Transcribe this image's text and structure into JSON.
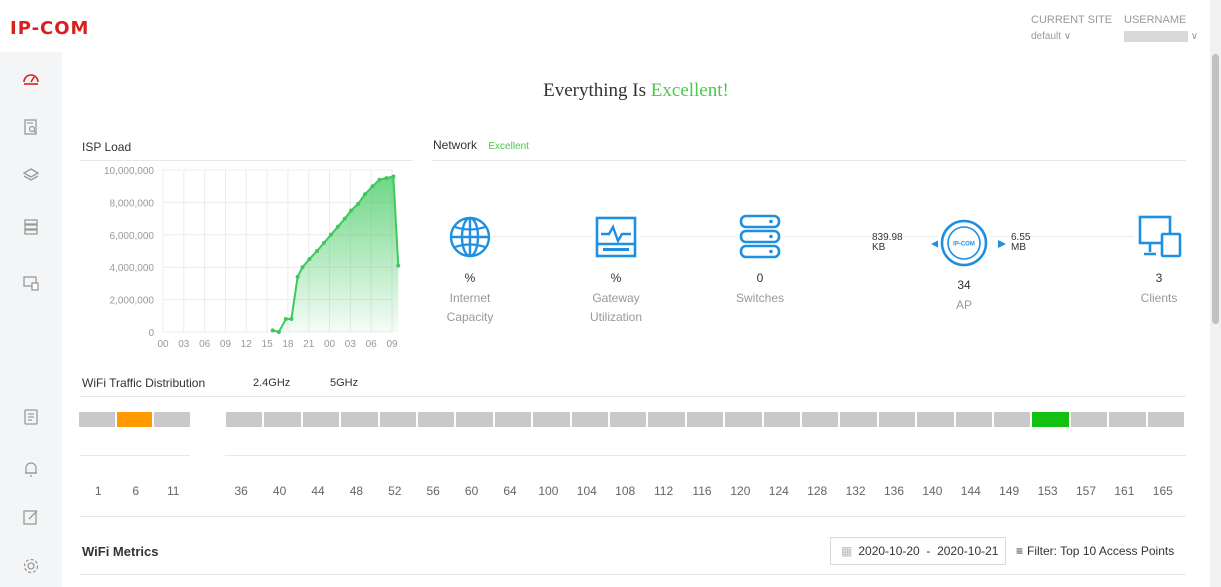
{
  "brand": {
    "logo": "IP-COM"
  },
  "header": {
    "current_site_label": "CURRENT SITE",
    "current_site_value": "default",
    "username_label": "USERNAME"
  },
  "sidebar": {
    "items": [
      {
        "icon": "dashboard-icon"
      },
      {
        "icon": "log-search-icon"
      },
      {
        "icon": "layers-icon"
      },
      {
        "icon": "server-stack-icon"
      },
      {
        "icon": "devices-icon"
      },
      {
        "icon": "document-icon"
      },
      {
        "icon": "bell-icon"
      },
      {
        "icon": "edit-icon"
      },
      {
        "icon": "settings-gear-icon"
      }
    ]
  },
  "status": {
    "prefix": "Everything Is",
    "word": "Excellent!"
  },
  "isp": {
    "title": "ISP Load",
    "y_ticks": [
      "10,000,000",
      "8,000,000",
      "6,000,000",
      "4,000,000",
      "2,000,000",
      "0"
    ],
    "x_ticks": [
      "00",
      "03",
      "06",
      "09",
      "12",
      "15",
      "18",
      "21",
      "00",
      "03",
      "06",
      "09"
    ]
  },
  "chart_data": {
    "type": "area",
    "title": "ISP Load",
    "xlabel": "",
    "ylabel": "",
    "ylim": [
      0,
      10000000
    ],
    "x_ticks": [
      "00",
      "03",
      "06",
      "09",
      "12",
      "15",
      "18",
      "21",
      "00",
      "03",
      "06",
      "09"
    ],
    "x": [
      15.8,
      16.7,
      17.7,
      18.5,
      19.4,
      20.1,
      21.1,
      22.2,
      23.2,
      24.2,
      25.2,
      26.2,
      27.1,
      28.1,
      29.1,
      30.2,
      31.2,
      32.2,
      33.2,
      33.9
    ],
    "values": [
      100000,
      0,
      800000,
      800000,
      3400000,
      4000000,
      4500000,
      5000000,
      5500000,
      6000000,
      6500000,
      7000000,
      7500000,
      7900000,
      8500000,
      9000000,
      9400000,
      9500000,
      9600000,
      4100000
    ],
    "grid": true,
    "color": "#3ec95c"
  },
  "network": {
    "title": "Network",
    "status": "Excellent",
    "internet": {
      "value": "%",
      "label1": "Internet",
      "label2": "Capacity"
    },
    "gateway": {
      "value": "%",
      "label1": "Gateway",
      "label2": "Utilization"
    },
    "switches": {
      "value": "0",
      "label": "Switches"
    },
    "ap": {
      "value": "34",
      "label": "AP",
      "down1": "839.98",
      "down2": "KB",
      "up1": "6.55",
      "up2": "MB",
      "badge": "IP-COM"
    },
    "clients": {
      "value": "3",
      "label": "Clients"
    }
  },
  "wifi": {
    "title": "WiFi Traffic Distribution",
    "tab_24": "2.4GHz",
    "tab_5": "5GHz",
    "channels_24": [
      "1",
      "6",
      "11"
    ],
    "channels_5": [
      "36",
      "40",
      "44",
      "48",
      "52",
      "56",
      "60",
      "64",
      "100",
      "104",
      "108",
      "112",
      "116",
      "120",
      "124",
      "128",
      "132",
      "136",
      "140",
      "144",
      "149",
      "153",
      "157",
      "161",
      "165"
    ],
    "active_24": "6",
    "active_5": "153",
    "colors": {
      "idle": "#c9c9c9",
      "active_24": "#ff9b00",
      "active_5": "#13c113"
    }
  },
  "metrics": {
    "title": "WiFi Metrics",
    "date_from": "2020-10-20",
    "date_sep": "-",
    "date_to": "2020-10-21",
    "filter": "Filter: Top 10 Access Points"
  }
}
